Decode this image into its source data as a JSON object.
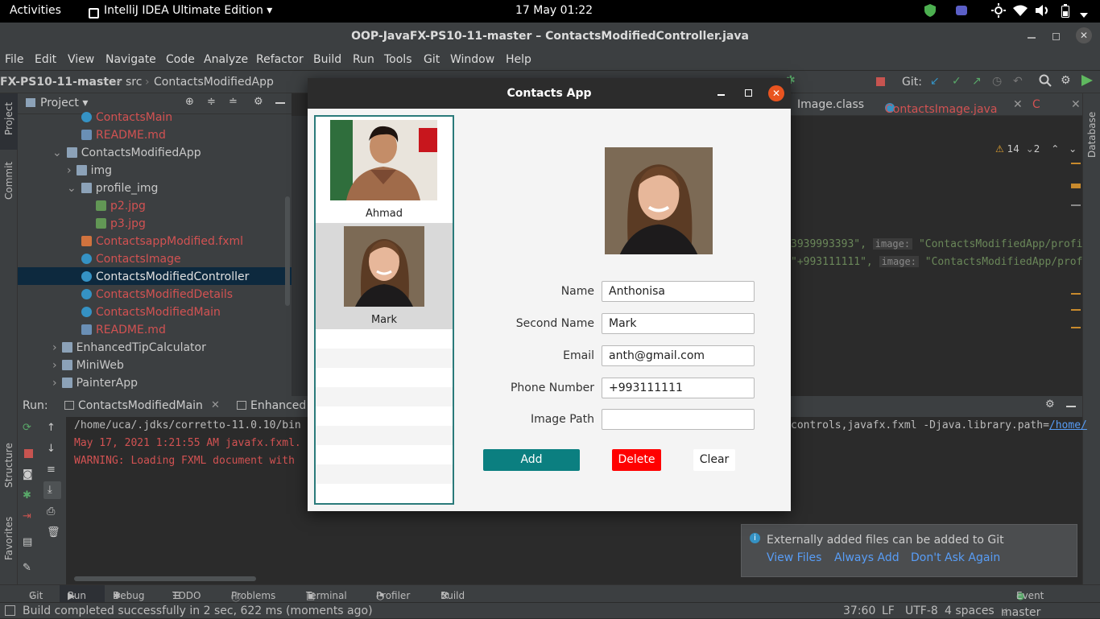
{
  "topbar": {
    "activities": "Activities",
    "app": "IntelliJ IDEA Ultimate Edition ▾",
    "clock": "17 May  01:22"
  },
  "window": {
    "title": "OOP-JavaFX-PS10-11-master – ContactsModifiedController.java"
  },
  "menu": [
    "File",
    "Edit",
    "View",
    "Navigate",
    "Code",
    "Analyze",
    "Refactor",
    "Build",
    "Run",
    "Tools",
    "Git",
    "Window",
    "Help"
  ],
  "nav": {
    "crumb1": "FX-PS10-11-master",
    "crumb2": "src",
    "crumb3": "ContactsModifiedApp",
    "git": "Git:"
  },
  "sidebar_left": {
    "project": "Project",
    "commit": "Commit",
    "structure": "Structure",
    "favorites": "Favorites"
  },
  "sidebar_right": {
    "database": "Database"
  },
  "project_panel": {
    "title": "Project ▾",
    "items": [
      {
        "label": "ContactsMain",
        "icon": "class-icon",
        "color": "red"
      },
      {
        "label": "README.md",
        "icon": "markdown-icon",
        "color": "red"
      },
      {
        "label": "ContactsModifiedApp",
        "icon": "folder-icon",
        "color": "white"
      },
      {
        "label": "img",
        "icon": "folder-icon",
        "color": "white"
      },
      {
        "label": "profile_img",
        "icon": "folder-icon",
        "color": "white"
      },
      {
        "label": "p2.jpg",
        "icon": "image-icon",
        "color": "red"
      },
      {
        "label": "p3.jpg",
        "icon": "image-icon",
        "color": "red"
      },
      {
        "label": "ContactsappModified.fxml",
        "icon": "fxml-icon",
        "color": "red"
      },
      {
        "label": "ContactsImage",
        "icon": "class-icon",
        "color": "red"
      },
      {
        "label": "ContactsModifiedController",
        "icon": "class-icon",
        "color": "red"
      },
      {
        "label": "ContactsModifiedDetails",
        "icon": "class-icon",
        "color": "red"
      },
      {
        "label": "ContactsModifiedMain",
        "icon": "class-icon",
        "color": "red"
      },
      {
        "label": "README.md",
        "icon": "markdown-icon",
        "color": "red"
      },
      {
        "label": "EnhancedTipCalculator",
        "icon": "folder-icon",
        "color": "white"
      },
      {
        "label": "MiniWeb",
        "icon": "folder-icon",
        "color": "white"
      },
      {
        "label": "PainterApp",
        "icon": "folder-icon",
        "color": "white"
      }
    ]
  },
  "editor": {
    "tabs": [
      "Image.class",
      "ContactsImage.java",
      "C"
    ],
    "warnings": "14",
    "weak_warnings": "2",
    "line1_code": "3939993393\",",
    "line1_hint": "image:",
    "line1_str": "\"ContactsModifiedApp/profi",
    "line2_code": "\"+993111111\",",
    "line2_hint": "image:",
    "line2_str": "\"ContactsModifiedApp/prof"
  },
  "run_panel": {
    "label": "Run:",
    "tab1": "ContactsModifiedMain",
    "tab2": "Enhanced",
    "line1": "/home/uca/.jdks/corretto-11.0.10/bin",
    "line1_right": "controls,javafx.fxml -Djava.library.path=",
    "line1_link": "/home/",
    "line2": "May 17, 2021 1:21:55 AM javafx.fxml.",
    "line3": "WARNING: Loading FXML document with"
  },
  "bottom_tabs": [
    "Git",
    "Run",
    "Debug",
    "TODO",
    "Problems",
    "Terminal",
    "Profiler",
    "Build"
  ],
  "event_log": "Event Log",
  "status": {
    "message": "Build completed successfully in 2 sec, 622 ms (moments ago)",
    "position": "37:60",
    "lf": "LF",
    "encoding": "UTF-8",
    "indent": "4 spaces",
    "branch": "master"
  },
  "notification": {
    "text": "Externally added files can be added to Git",
    "view": "View Files",
    "always": "Always Add",
    "dont": "Don't Ask Again"
  },
  "dialog": {
    "title": "Contacts App",
    "contacts": [
      {
        "name": "Ahmad"
      },
      {
        "name": "Mark"
      }
    ],
    "form": {
      "name_label": "Name",
      "name_value": "Anthonisa",
      "second_label": "Second Name",
      "second_value": "Mark",
      "email_label": "Email",
      "email_value": "anth@gmail.com",
      "phone_label": "Phone Number",
      "phone_value": "+993111111",
      "image_label": "Image Path",
      "image_value": ""
    },
    "buttons": {
      "add": "Add",
      "delete": "Delete",
      "clear": "Clear"
    },
    "colors": {
      "add": "#0b7f80",
      "delete": "#ff0000",
      "border": "#2a7a7a",
      "selected": "#d9d9d9"
    }
  }
}
